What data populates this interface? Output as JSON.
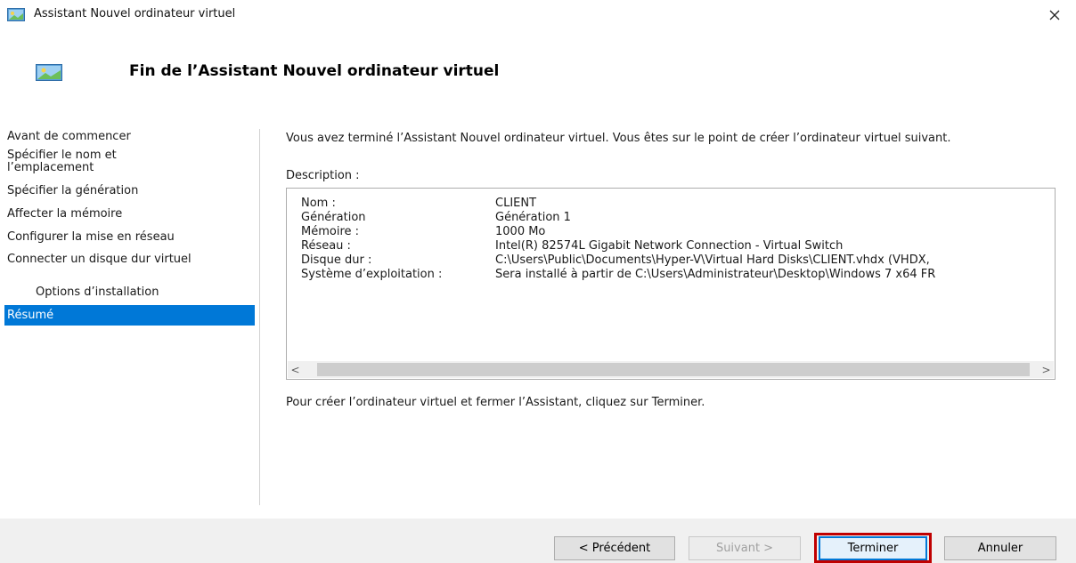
{
  "window": {
    "title": "Assistant Nouvel ordinateur virtuel"
  },
  "header": {
    "title": "Fin de l’Assistant Nouvel ordinateur virtuel"
  },
  "nav": {
    "items": [
      {
        "label": "Avant de commencer"
      },
      {
        "label": "Spécifier le nom et l’emplacement"
      },
      {
        "label": "Spécifier la génération"
      },
      {
        "label": "Affecter la mémoire"
      },
      {
        "label": "Configurer la mise en réseau"
      },
      {
        "label": "Connecter un disque dur virtuel"
      },
      {
        "label": "Options d’installation"
      },
      {
        "label": "Résumé"
      }
    ],
    "selected": "Résumé"
  },
  "main": {
    "intro": "Vous avez terminé l’Assistant Nouvel ordinateur virtuel. Vous êtes sur le point de créer l’ordinateur virtuel suivant.",
    "description_label": "Description :",
    "summary": [
      {
        "key": "Nom :",
        "value": "CLIENT"
      },
      {
        "key": "Génération",
        "value": "Génération 1"
      },
      {
        "key": "Mémoire :",
        "value": "1000 Mo"
      },
      {
        "key": "Réseau :",
        "value": "Intel(R) 82574L Gigabit Network Connection - Virtual Switch"
      },
      {
        "key": "Disque dur :",
        "value": "C:\\Users\\Public\\Documents\\Hyper-V\\Virtual Hard Disks\\CLIENT.vhdx (VHDX, "
      },
      {
        "key": "Système d’exploitation :",
        "value": "Sera installé à partir de C:\\Users\\Administrateur\\Desktop\\Windows 7 x64 FR"
      }
    ],
    "scroll_left": "<",
    "scroll_right": ">",
    "outro": "Pour créer l’ordinateur virtuel et fermer l’Assistant, cliquez sur Terminer."
  },
  "footer": {
    "previous_label": "< Précédent",
    "next_label": "Suivant >",
    "finish_label": "Terminer",
    "cancel_label": "Annuler"
  },
  "colors": {
    "selection": "#0078d7",
    "highlight_frame": "#c00000",
    "footer_bg": "#f0f0f0"
  },
  "icons": {
    "title": "hyperv-window-icon",
    "header": "hyperv-window-icon",
    "close": "close-icon"
  }
}
